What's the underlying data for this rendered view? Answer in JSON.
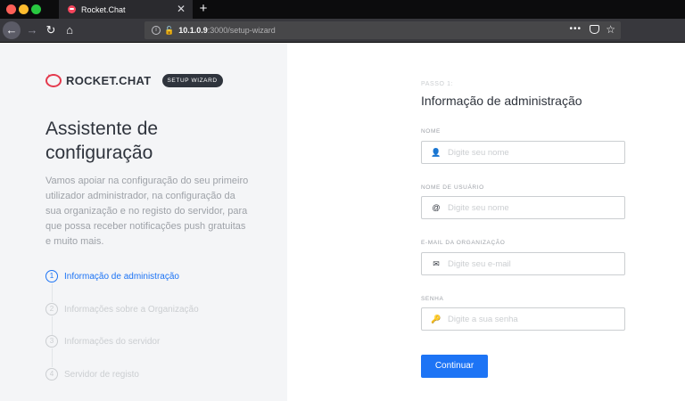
{
  "browser": {
    "tab_title": "Rocket.Chat",
    "tab_close": "✕",
    "new_tab": "+",
    "url_host": "10.1.0.9",
    "url_path": ":3000/setup-wizard",
    "menu_dots": "•••"
  },
  "sidebar": {
    "logo_text": "ROCKET.CHAT",
    "badge": "SETUP WIZARD",
    "title": "Assistente de configuração",
    "description": "Vamos apoiar na configuração do seu primeiro utilizador administrador, na configuração da sua organização e no registo do servidor, para que possa receber notificações push gratuitas e muito mais.",
    "steps": [
      {
        "num": "1",
        "label": "Informação de administração"
      },
      {
        "num": "2",
        "label": "Informações sobre a Organização"
      },
      {
        "num": "3",
        "label": "Informações do servidor"
      },
      {
        "num": "4",
        "label": "Servidor de registo"
      }
    ]
  },
  "form": {
    "step_label": "PASSO 1:",
    "title": "Informação de administração",
    "fields": [
      {
        "label": "NOME",
        "placeholder": "Digite seu nome",
        "icon": "user-icon"
      },
      {
        "label": "NOME DE USUÁRIO",
        "placeholder": "Digite seu nome",
        "icon": "at-icon"
      },
      {
        "label": "E-MAIL DA ORGANIZAÇÃO",
        "placeholder": "Digite seu e-mail",
        "icon": "mail-icon"
      },
      {
        "label": "SENHA",
        "placeholder": "Digite a sua senha",
        "icon": "key-icon"
      }
    ],
    "submit_label": "Continuar"
  },
  "colors": {
    "accent": "#1d74f5",
    "brand": "#e4394d",
    "left_bg": "#f4f5f7",
    "text_dark": "#2f343d",
    "text_muted": "#9ea2a8"
  }
}
